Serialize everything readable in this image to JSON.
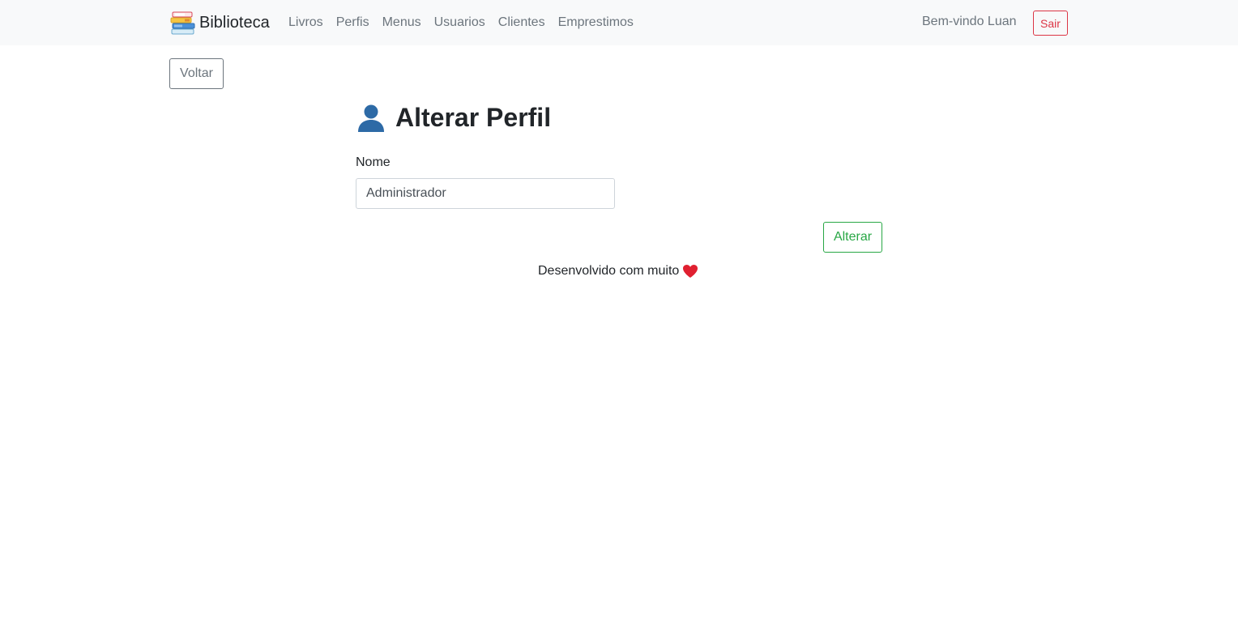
{
  "navbar": {
    "brand": {
      "text": "Biblioteca",
      "icon": "books-icon"
    },
    "links": [
      "Livros",
      "Perfis",
      "Menus",
      "Usuarios",
      "Clientes",
      "Emprestimos"
    ],
    "welcome": "Bem-vindo Luan",
    "logout_label": "Sair"
  },
  "back_label": "Voltar",
  "page": {
    "title": "Alterar Perfil",
    "title_icon": "user-silhouette-icon"
  },
  "form": {
    "name_label": "Nome",
    "name_value": "Administrador",
    "submit_label": "Alterar"
  },
  "footer": {
    "text": "Desenvolvido com muito",
    "icon": "heart-icon"
  },
  "colors": {
    "navbar_bg": "#f8f9fa",
    "muted": "#6c757d",
    "danger": "#dc3545",
    "success": "#28a745",
    "heart": "#e02030"
  }
}
